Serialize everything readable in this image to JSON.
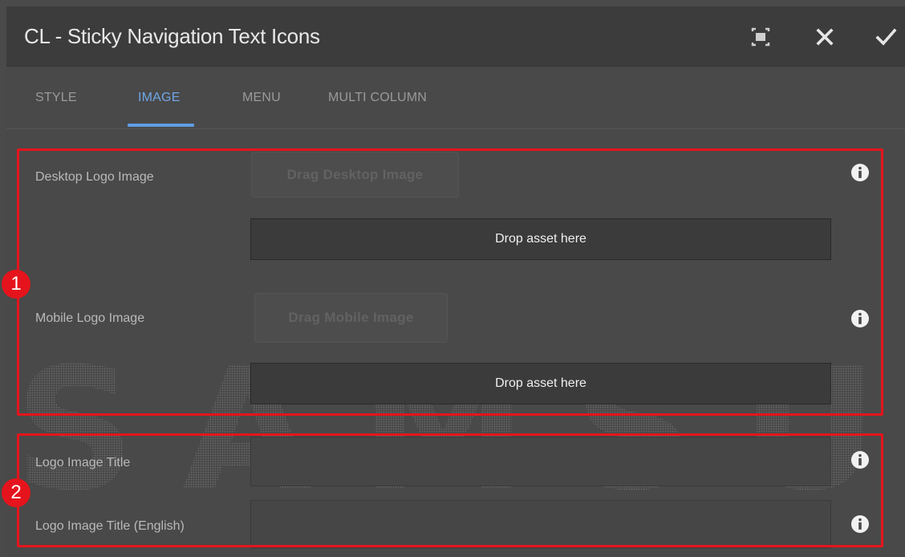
{
  "dialog": {
    "title": "CL - Sticky Navigation Text Icons",
    "toolbar": {
      "fullscreen_icon": "fullscreen-icon",
      "close_icon": "close-icon",
      "confirm_icon": "check-icon"
    }
  },
  "tabs": [
    {
      "label": "STYLE",
      "active": false
    },
    {
      "label": "IMAGE",
      "active": true
    },
    {
      "label": "MENU",
      "active": false
    },
    {
      "label": "MULTI COLUMN",
      "active": false
    }
  ],
  "watermark_text": "SAMSUNG",
  "fields": {
    "desktop_logo": {
      "label": "Desktop Logo Image",
      "drag_label": "Drag Desktop Image",
      "dropzone": "Drop asset here"
    },
    "mobile_logo": {
      "label": "Mobile Logo Image",
      "drag_label": "Drag Mobile Image",
      "dropzone": "Drop asset here"
    },
    "logo_title": {
      "label": "Logo Image Title",
      "value": ""
    },
    "logo_title_english": {
      "label": "Logo Image Title (English)",
      "value": ""
    }
  },
  "annotations": [
    {
      "number": "1"
    },
    {
      "number": "2"
    }
  ],
  "colors": {
    "accent": "#5f9de6",
    "highlight": "#e5141c",
    "header_bg": "#3c3c3c",
    "panel_bg": "#494949"
  }
}
